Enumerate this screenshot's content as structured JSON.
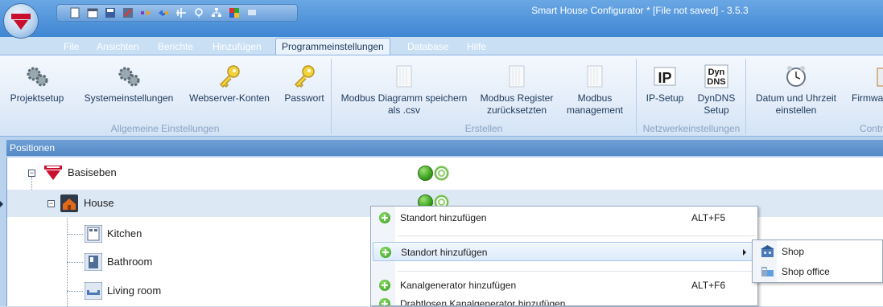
{
  "window": {
    "title": "Smart House Configurator * [File not saved] - 3.5.3",
    "accent_color": "#3f86d3"
  },
  "quick_access_toolbar": {
    "icons": [
      "new-file-icon",
      "open-icon",
      "save-icon",
      "edit-icon",
      "import-icon",
      "export-icon",
      "grid-icon",
      "network-icon",
      "tree-icon",
      "colors-icon",
      "dropdown-icon"
    ]
  },
  "ribbon": {
    "tabs": [
      {
        "label": "File"
      },
      {
        "label": "Ansichten"
      },
      {
        "label": "Berichte"
      },
      {
        "label": "Hinzufügen"
      },
      {
        "label": "Programmeinstellungen",
        "active": true
      },
      {
        "label": "Database"
      },
      {
        "label": "Hilfe"
      }
    ],
    "groups": {
      "allgemeine": {
        "label": "Allgemeine Einstellungen",
        "buttons": {
          "projektsetup": "Projektsetup",
          "systemeinstellungen": "Systemeinstellungen",
          "webserver": "Webserver-Konten",
          "passwort": "Passwort"
        }
      },
      "erstellen": {
        "label": "Erstellen",
        "buttons": {
          "modbus_diagramm": "Modbus Diagramm speichern als .csv",
          "modbus_register": "Modbus Register zurücksetzten",
          "modbus_management": "Modbus management"
        }
      },
      "netzwerk": {
        "label": "Netzwerkeinstellungen",
        "buttons": {
          "ip_setup": "IP-Setup",
          "dyndns_setup": "DynDNS Setup"
        },
        "ip_icon_text": "IP",
        "dyndns_icon_text_1": "Dyn",
        "dyndns_icon_text_2": "DNS"
      },
      "controller": {
        "label": "Controller",
        "buttons": {
          "datum_uhrzeit": "Datum und Uhrzeit einstellen",
          "firmware": "Firmwa"
        }
      }
    }
  },
  "positions_panel": {
    "title": "Positionen",
    "tree": [
      {
        "label": "Basiseben",
        "icon": "carlo-gavazzi-logo-icon",
        "expanded": true,
        "status": [
          "green-led-icon",
          "signal-icon"
        ]
      },
      {
        "label": "House",
        "icon": "house-icon",
        "expanded": true,
        "selected": true,
        "status": [
          "green-led-icon",
          "signal-icon"
        ]
      },
      {
        "label": "Kitchen",
        "icon": "kitchen-icon"
      },
      {
        "label": "Bathroom",
        "icon": "bathroom-icon"
      },
      {
        "label": "Living room",
        "icon": "living-room-icon"
      }
    ]
  },
  "context_menu": {
    "items": [
      {
        "label": "Standort hinzufügen",
        "shortcut": "ALT+F5"
      },
      {
        "label": "Standort hinzufügen",
        "has_submenu": true,
        "highlighted": true
      },
      {
        "label": "Kanalgenerator hinzufügen",
        "shortcut": "ALT+F6"
      },
      {
        "label": "Drahtlosen Kanalgenerator hinzufügen"
      }
    ],
    "submenu": [
      {
        "label": "Shop",
        "icon": "shop-icon"
      },
      {
        "label": "Shop office",
        "icon": "shop-office-icon"
      }
    ]
  }
}
